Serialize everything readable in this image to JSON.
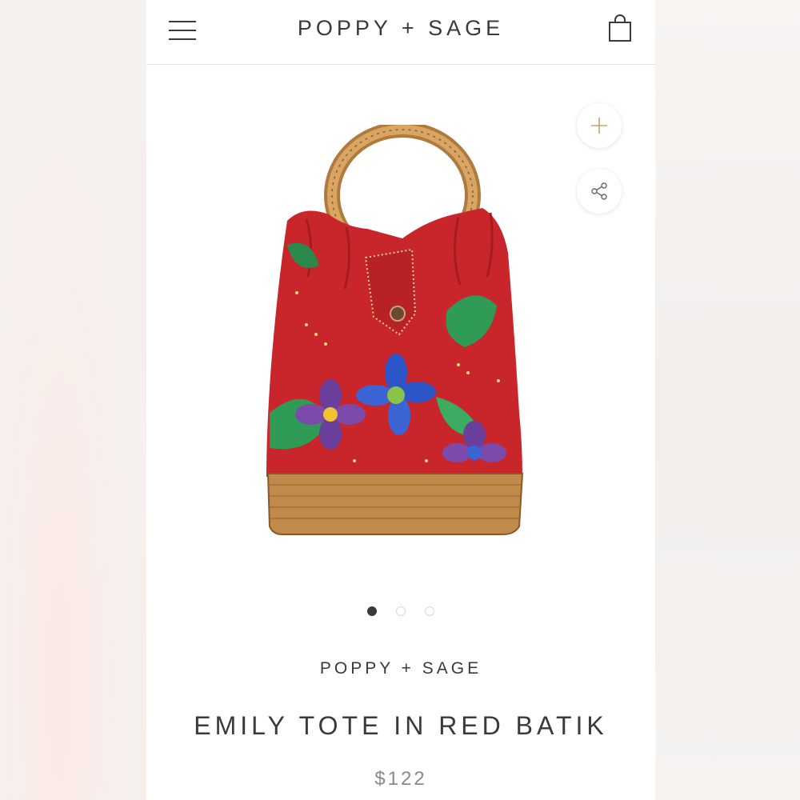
{
  "header": {
    "brand": "POPPY + SAGE",
    "menu_icon": "hamburger-menu-icon",
    "cart_icon": "shopping-bag-icon"
  },
  "gallery": {
    "image_alt": "Emily Tote in Red Batik",
    "current_slide": 1,
    "total_slides": 3,
    "actions": [
      {
        "icon": "plus-icon"
      },
      {
        "icon": "share-icon"
      }
    ]
  },
  "product": {
    "vendor": "POPPY + SAGE",
    "title": "EMILY TOTE IN RED BATIK",
    "price": "$122"
  },
  "colors": {
    "text": "#3a3a3a",
    "price": "#8a8a8a",
    "fabric_red": "#c8262a",
    "rattan": "#c08a4a"
  }
}
